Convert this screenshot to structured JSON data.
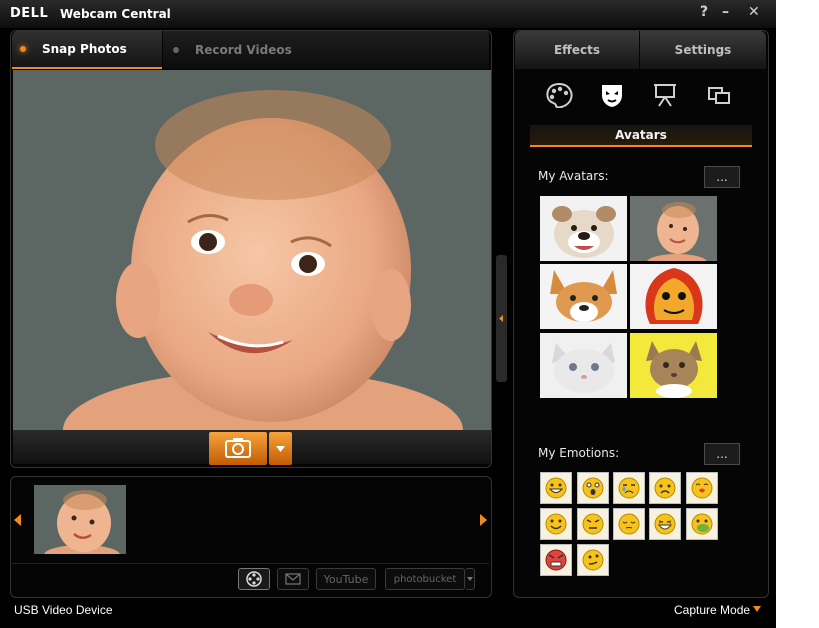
{
  "window": {
    "logo": "DELL",
    "title": "Webcam Central",
    "help": "?",
    "minimize": "–",
    "close": "✕"
  },
  "left_tabs": [
    {
      "label": "Snap Photos",
      "active": true
    },
    {
      "label": "Record Videos",
      "active": false
    }
  ],
  "right_tabs": [
    {
      "label": "Effects",
      "active": true
    },
    {
      "label": "Settings",
      "active": false
    }
  ],
  "effects": {
    "icons": [
      "palette-icon",
      "avatar-mask-icon",
      "presentation-icon",
      "pip-icon"
    ],
    "active_label": "Avatars"
  },
  "avatars_section": {
    "label": "My Avatars:",
    "more": "..."
  },
  "emotions_section": {
    "label": "My Emotions:",
    "more": "..."
  },
  "share_bar": {
    "youtube": "YouTube",
    "photobucket": "photobucket"
  },
  "status": {
    "device": "USB Video Device",
    "mode": "Capture Mode"
  },
  "colors": {
    "accent": "#f08a1c",
    "panel": "#050505"
  }
}
